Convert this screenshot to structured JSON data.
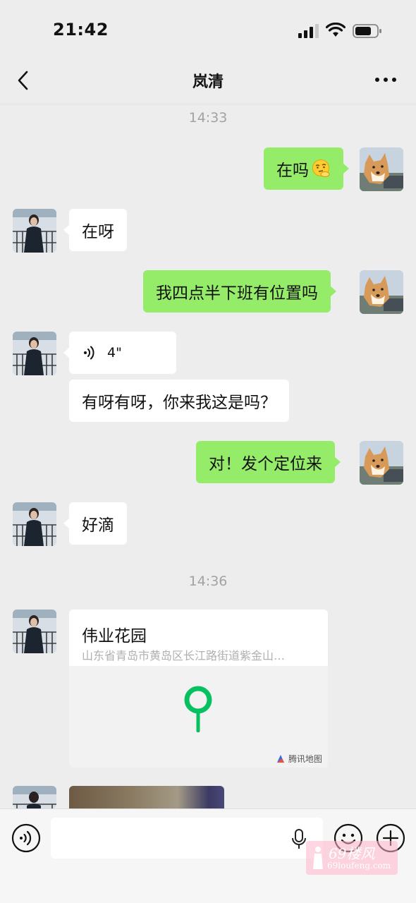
{
  "status_bar": {
    "time": "21:42"
  },
  "nav": {
    "title": "岚清"
  },
  "timestamps": [
    "14:33",
    "14:36"
  ],
  "messages": [
    {
      "side": "out",
      "text": "在吗",
      "emoji": "thinking-face-icon"
    },
    {
      "side": "in",
      "text": "在呀"
    },
    {
      "side": "out",
      "text": "我四点半下班有位置吗"
    },
    {
      "side": "in",
      "type": "voice",
      "duration": "4\""
    },
    {
      "side": "in",
      "text": "有呀有呀，你来我这是吗？"
    },
    {
      "side": "out",
      "text": "对！发个定位来"
    },
    {
      "side": "in",
      "text": "好滴"
    },
    {
      "side": "in",
      "type": "location",
      "name": "伟业花园",
      "address": "山东省青岛市黄岛区长江路街道紫金山…",
      "map_brand": "腾讯地图"
    }
  ],
  "input": {
    "placeholder": ""
  },
  "watermark": {
    "top": "69楼风",
    "bottom": "69loufeng.com"
  },
  "colors": {
    "outgoing_bubble": "#95ec69",
    "incoming_bubble": "#ffffff",
    "background": "#ededed",
    "pin": "#07c160"
  }
}
